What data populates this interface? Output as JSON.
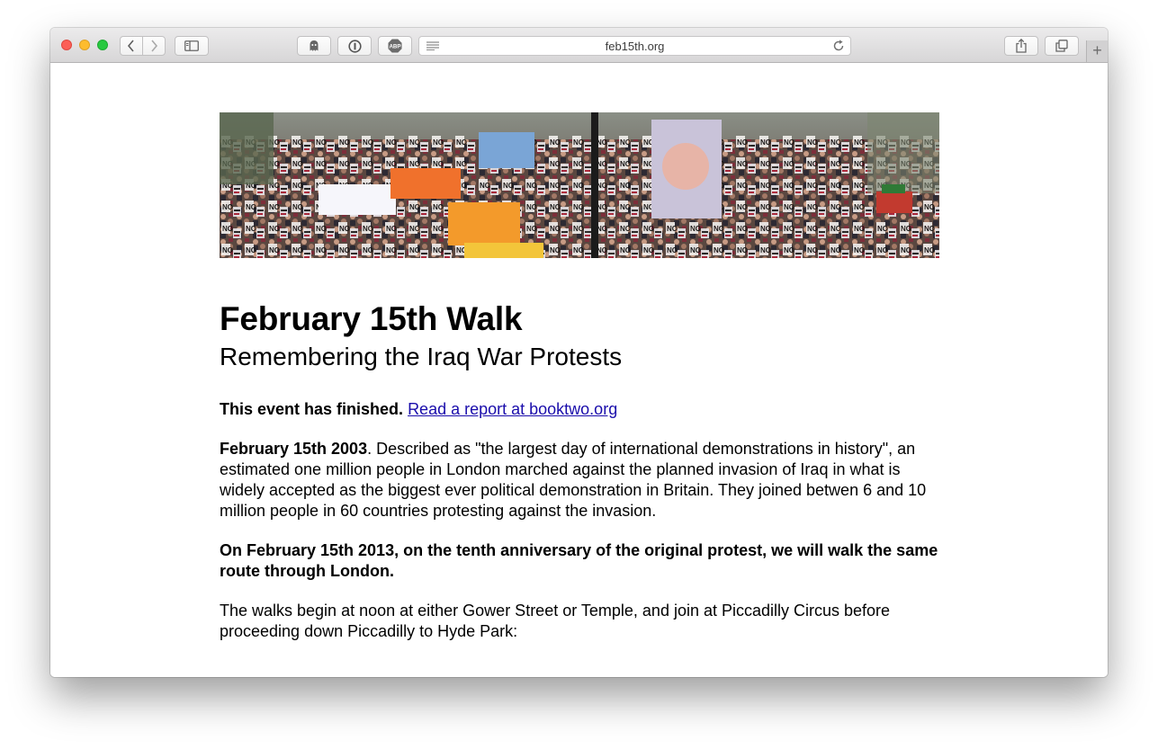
{
  "browser": {
    "url": "feb15th.org",
    "icons": {
      "back": "chevron-left-icon",
      "forward": "chevron-right-icon",
      "sidebar": "sidebar-icon",
      "ghostery": "ghost-icon",
      "onepassword": "onepassword-icon",
      "adblock": "abp-icon",
      "reader": "reader-icon",
      "reload": "reload-icon",
      "share": "share-icon",
      "tabs": "tabs-icon",
      "new_tab": "plus-icon"
    },
    "abp_label": "ABP",
    "new_tab_label": "+"
  },
  "page": {
    "title": "February 15th Walk",
    "subtitle": "Remembering the Iraq War Protests",
    "status_bold": "This event has finished.",
    "status_link": "Read a report at booktwo.org",
    "history_bold": "February 15th 2003",
    "history_text": ". Described as \"the largest day of international demonstrations in history\", an estimated one million people in London marched against the planned invasion of Iraq in what is widely accepted as the biggest ever political demonstration in Britain. They joined betwen 6 and 10 million people in 60 countries protesting against the invasion.",
    "walk_text": "On February 15th 2013, on the tenth anniversary of the original protest, we will walk the same route through London.",
    "route_text": "The walks begin at noon at either Gower Street or Temple, and join at Piccadilly Circus before proceeding down Piccadilly to Hyde Park:"
  },
  "colors": {
    "link": "#1a0dab",
    "close": "#fc5f57",
    "minimize": "#fdbc2e",
    "maximize": "#28c940"
  }
}
